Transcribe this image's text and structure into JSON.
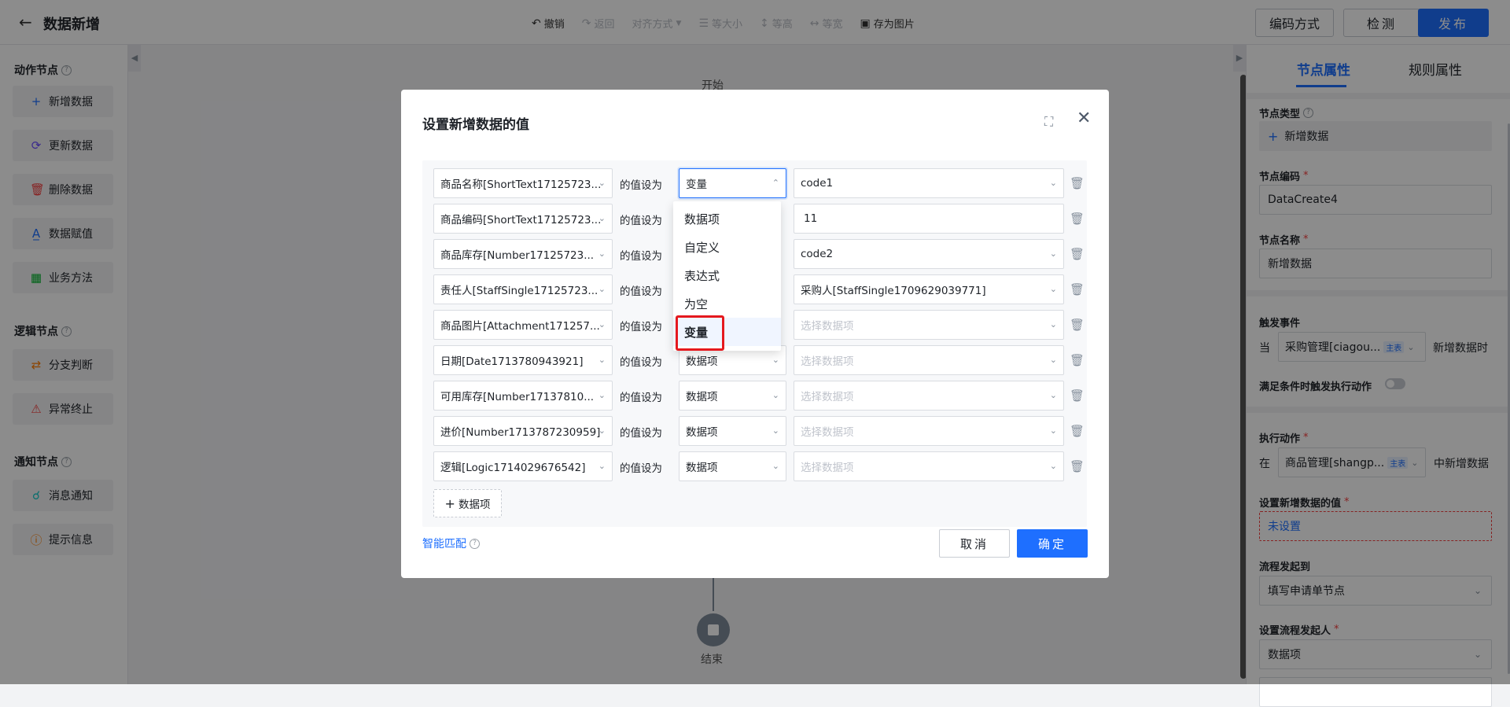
{
  "header": {
    "back_icon": "arrow-left-icon",
    "title": "数据新增",
    "toolbar": [
      {
        "label": "撤销",
        "icon": "undo-icon",
        "enabled": true
      },
      {
        "label": "返回",
        "icon": "redo-icon",
        "enabled": false
      },
      {
        "label": "对齐方式",
        "icon": "align-icon",
        "enabled": false
      },
      {
        "label": "等大小",
        "icon": "same-size-icon",
        "enabled": false
      },
      {
        "label": "等高",
        "icon": "same-height-icon",
        "enabled": false
      },
      {
        "label": "等宽",
        "icon": "same-width-icon",
        "enabled": false
      },
      {
        "label": "存为图片",
        "icon": "image-icon",
        "enabled": true
      }
    ],
    "encode_label": "编码方式",
    "check_label": "检测",
    "publish_label": "发布"
  },
  "left_panel": {
    "action_title": "动作节点",
    "action_items": [
      {
        "label": "新增数据",
        "icon": "plus-icon"
      },
      {
        "label": "更新数据",
        "icon": "refresh-icon"
      },
      {
        "label": "删除数据",
        "icon": "trash-icon"
      },
      {
        "label": "数据赋值",
        "icon": "assign-icon"
      },
      {
        "label": "业务方法",
        "icon": "table-icon"
      }
    ],
    "logic_title": "逻辑节点",
    "logic_items": [
      {
        "label": "分支判断",
        "icon": "branch-icon"
      },
      {
        "label": "异常终止",
        "icon": "warning-icon"
      }
    ],
    "notify_title": "通知节点",
    "notify_items": [
      {
        "label": "消息通知",
        "icon": "megaphone-icon"
      },
      {
        "label": "提示信息",
        "icon": "info-icon"
      }
    ]
  },
  "canvas": {
    "start_label": "开始",
    "end_label": "结束"
  },
  "right_panel": {
    "tabs": [
      "节点属性",
      "规则属性"
    ],
    "active_tab": "节点属性",
    "node_type_label": "节点类型",
    "node_type_value": "新增数据",
    "node_code_label": "节点编码",
    "node_code_value": "DataCreate4",
    "node_name_label": "节点名称",
    "node_name_value": "新增数据",
    "trigger_label": "触发事件",
    "trigger_prefix": "当",
    "trigger_form": "采购管理[ciagou...",
    "trigger_tag": "主表",
    "trigger_suffix": "新增数据时",
    "condition_label": "满足条件时触发执行动作",
    "action_label": "执行动作",
    "action_prefix": "在",
    "action_form": "商品管理[shangp...",
    "action_tag": "主表",
    "action_suffix": "中新增数据",
    "set_value_label": "设置新增数据的值",
    "set_value_status": "未设置",
    "flow_start_label": "流程发起到",
    "flow_start_value": "填写申请单节点",
    "flow_initiator_label": "设置流程发起人",
    "flow_initiator_value": "数据项"
  },
  "modal": {
    "title": "设置新增数据的值",
    "assign_text": "的值设为",
    "rows": [
      {
        "field": "商品名称[ShortText17125723...",
        "type": "变量",
        "value": "code1",
        "placeholder": false
      },
      {
        "field": "商品编码[ShortText17125723...",
        "type": "",
        "value": "11",
        "placeholder": false
      },
      {
        "field": "商品库存[Number17125723...",
        "type": "",
        "value": "code2",
        "placeholder": false
      },
      {
        "field": "责任人[StaffSingle17125723...",
        "type": "",
        "value": "采购人[StaffSingle1709629039771]",
        "placeholder": false
      },
      {
        "field": "商品图片[Attachment171257...",
        "type": "",
        "value": "选择数据项",
        "placeholder": true
      },
      {
        "field": "日期[Date1713780943921]",
        "type": "数据项",
        "value": "选择数据项",
        "placeholder": true
      },
      {
        "field": "可用库存[Number17137810...",
        "type": "数据项",
        "value": "选择数据项",
        "placeholder": true
      },
      {
        "field": "进价[Number1713787230959]",
        "type": "数据项",
        "value": "选择数据项",
        "placeholder": true
      },
      {
        "field": "逻辑[Logic1714029676542]",
        "type": "数据项",
        "value": "选择数据项",
        "placeholder": true
      }
    ],
    "add_label": "数据项",
    "dropdown_options": [
      "数据项",
      "自定义",
      "表达式",
      "为空",
      "变量"
    ],
    "dropdown_selected": "变量",
    "smart_match_label": "智能匹配",
    "cancel_label": "取消",
    "ok_label": "确定"
  },
  "colors": {
    "primary": "#1e6fff",
    "danger": "#f53f3f",
    "highlight": "#e5191e"
  }
}
